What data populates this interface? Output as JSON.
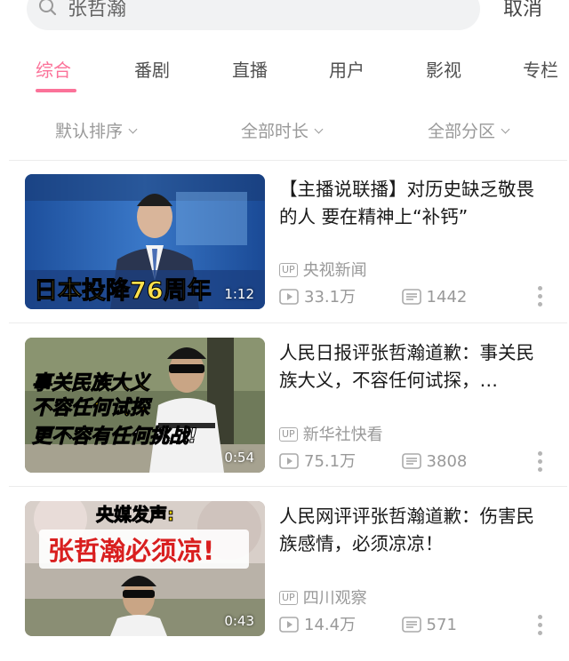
{
  "search": {
    "query": "张哲瀚",
    "cancel_label": "取消"
  },
  "tabs": [
    {
      "label": "综合",
      "active": true
    },
    {
      "label": "番剧",
      "active": false
    },
    {
      "label": "直播",
      "active": false
    },
    {
      "label": "用户",
      "active": false
    },
    {
      "label": "影视",
      "active": false
    },
    {
      "label": "专栏",
      "active": false
    }
  ],
  "filters": [
    {
      "label": "默认排序"
    },
    {
      "label": "全部时长"
    },
    {
      "label": "全部分区"
    }
  ],
  "results": [
    {
      "title": "【主播说联播】对历史缺乏敬畏的人 要在精神上“补钙”",
      "uploader": "央视新闻",
      "up_badge": "UP",
      "views": "33.1万",
      "comments": "1442",
      "duration": "1:12",
      "thumb_caption": "日本投降76周年"
    },
    {
      "title": "人民日报评张哲瀚道歉：事关民族大义，不容任何试探，…",
      "uploader": "新华社快看",
      "up_badge": "UP",
      "views": "75.1万",
      "comments": "3808",
      "duration": "0:54",
      "thumb_caption_lines": [
        "事关民族大义",
        "不容任何试探",
        "更不容有任何挑战!"
      ]
    },
    {
      "title": "人民网评评张哲瀚道歉：伤害民族感情，必须凉凉！",
      "uploader": "四川观察",
      "up_badge": "UP",
      "views": "14.4万",
      "comments": "571",
      "duration": "0:43",
      "thumb_caption_lines": [
        "央媒发声:",
        "张哲瀚必须凉!"
      ]
    }
  ],
  "colors": {
    "accent": "#fb7299",
    "muted": "#999999"
  }
}
